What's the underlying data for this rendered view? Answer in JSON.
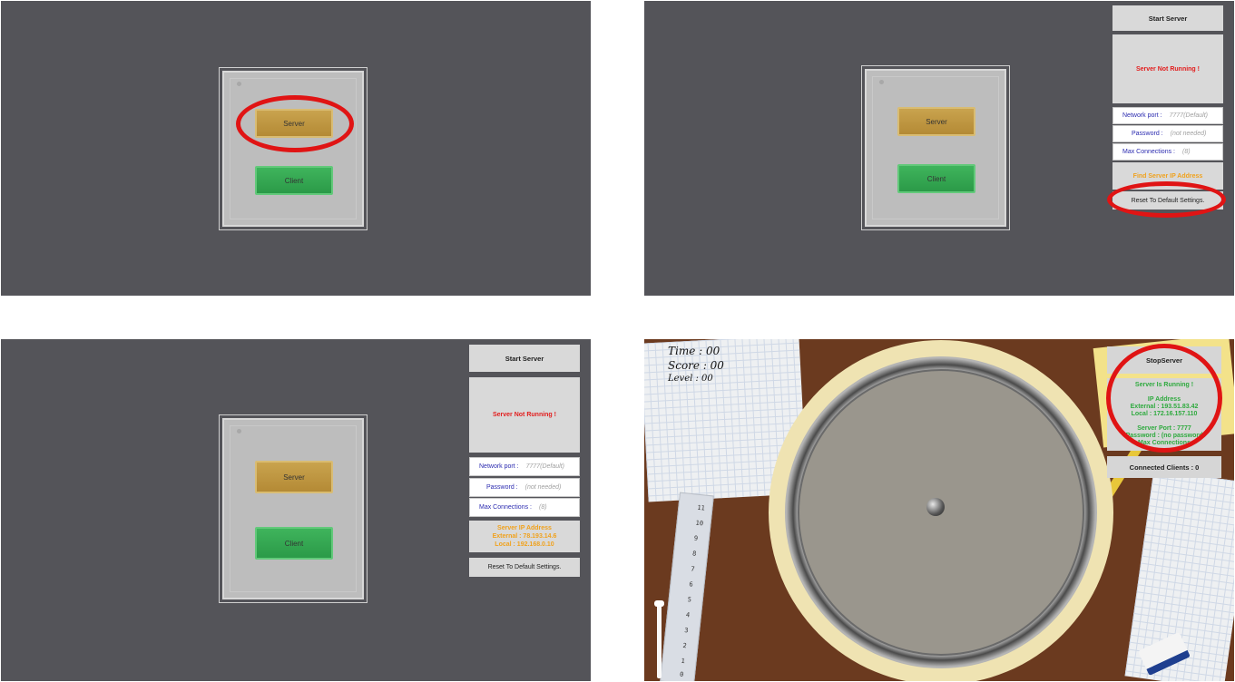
{
  "menu": {
    "server_label": "Server",
    "client_label": "Client"
  },
  "server_panel": {
    "start_label": "Start Server",
    "status_not_running": "Server Not Running !",
    "network_port_label": "Network port :",
    "network_port_hint": "7777(Default)",
    "password_label": "Password :",
    "password_hint": "(not needed)",
    "max_connections_label": "Max Connections :",
    "max_connections_hint": "(8)",
    "find_ip_label": "Find Server IP Address",
    "reset_label": "Reset To Default Settings.",
    "ip_result": {
      "title": "Server IP Address",
      "external": "External : 78.193.14.6",
      "local": "Local : 192.168.0.10"
    }
  },
  "game": {
    "time": "Time : 00",
    "score": "Score : 00",
    "level": "Level : 00",
    "stop_label": "StopServer",
    "status_running": "Server Is Running !",
    "ip_title": "IP Address",
    "external": "External : 193.51.83.42",
    "local": "Local : 172.16.157.110",
    "server_port": "Server Port : 7777",
    "password": "Password : (no password",
    "max_connections": "Max Connections",
    "connected_clients": "Connected Clients : 0",
    "ruler_marks": [
      "11",
      "10",
      "9",
      "8",
      "7",
      "6",
      "5",
      "4",
      "3",
      "2",
      "1",
      "0"
    ]
  },
  "colors": {
    "annotation": "#e01414",
    "status_error": "#e21d1d",
    "status_ok": "#2faa3f",
    "accent_orange": "#f0a21e"
  }
}
